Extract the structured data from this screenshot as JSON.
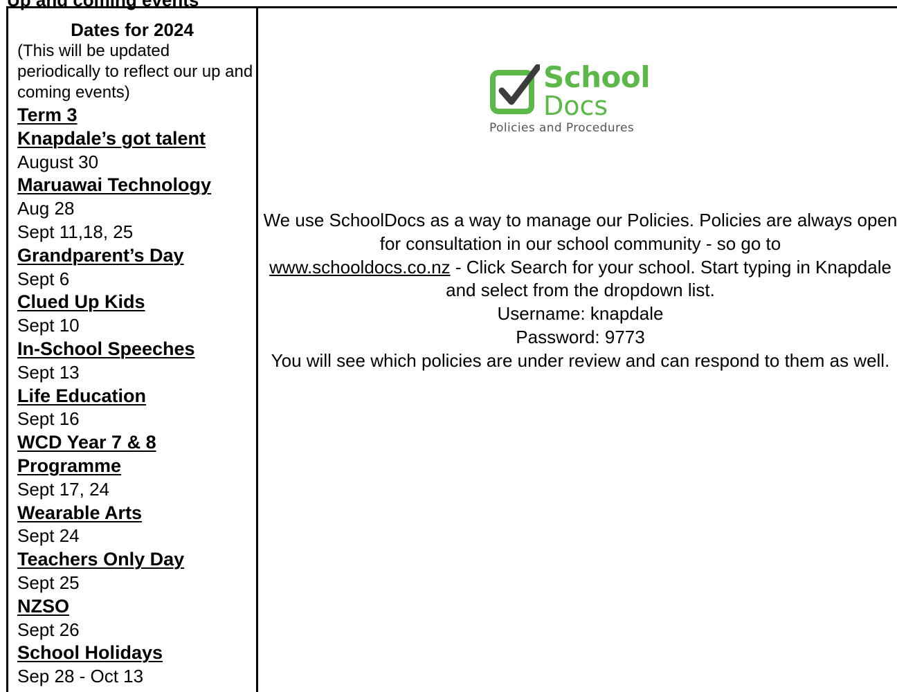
{
  "section_heading": "Up and coming events",
  "left": {
    "title": "Dates for 2024",
    "intro": "(This will be updated periodically to reflect our up and coming events)",
    "events": [
      {
        "name": "Term 3",
        "dates": []
      },
      {
        "name": "Knapdale’s got talent",
        "dates": [
          "August 30"
        ]
      },
      {
        "name": "Maruawai Technology",
        "dates": [
          "Aug 28",
          "Sept 11,18, 25"
        ]
      },
      {
        "name": "Grandparent’s Day",
        "dates": [
          "Sept 6"
        ]
      },
      {
        "name": "Clued Up Kids",
        "dates": [
          "Sept 10"
        ]
      },
      {
        "name": "In-School Speeches",
        "dates": [
          "Sept 13"
        ]
      },
      {
        "name": "Life Education",
        "dates": [
          "Sept 16"
        ]
      },
      {
        "name": "WCD Year 7 & 8 Programme",
        "dates": [
          "Sept 17, 24"
        ]
      },
      {
        "name": "Wearable Arts",
        "dates": [
          "Sept 24"
        ]
      },
      {
        "name": "Teachers Only Day",
        "dates": [
          "Sept 25"
        ]
      },
      {
        "name": "NZSO",
        "dates": [
          "Sept 26"
        ]
      },
      {
        "name": "School Holidays",
        "dates": [
          "Sep 28 - Oct 13"
        ]
      }
    ]
  },
  "right": {
    "logo": {
      "word1": "School",
      "word2": "Docs",
      "tagline": "Policies and Procedures",
      "brand_color": "#5bb849",
      "icon": "checkbox-check-icon"
    },
    "paragraph_before_link": "We use SchoolDocs as a way to manage our Policies. Policies are always open for consultation in our school community - so go to",
    "link_text": "www.schooldocs.co.nz",
    "paragraph_after_link": " - Click Search for your school. Start typing in Knapdale and select from the dropdown list.",
    "username": "Username: knapdale",
    "password": "Password: 9773",
    "closing": "You will see which policies are under review and can respond to them as well."
  }
}
